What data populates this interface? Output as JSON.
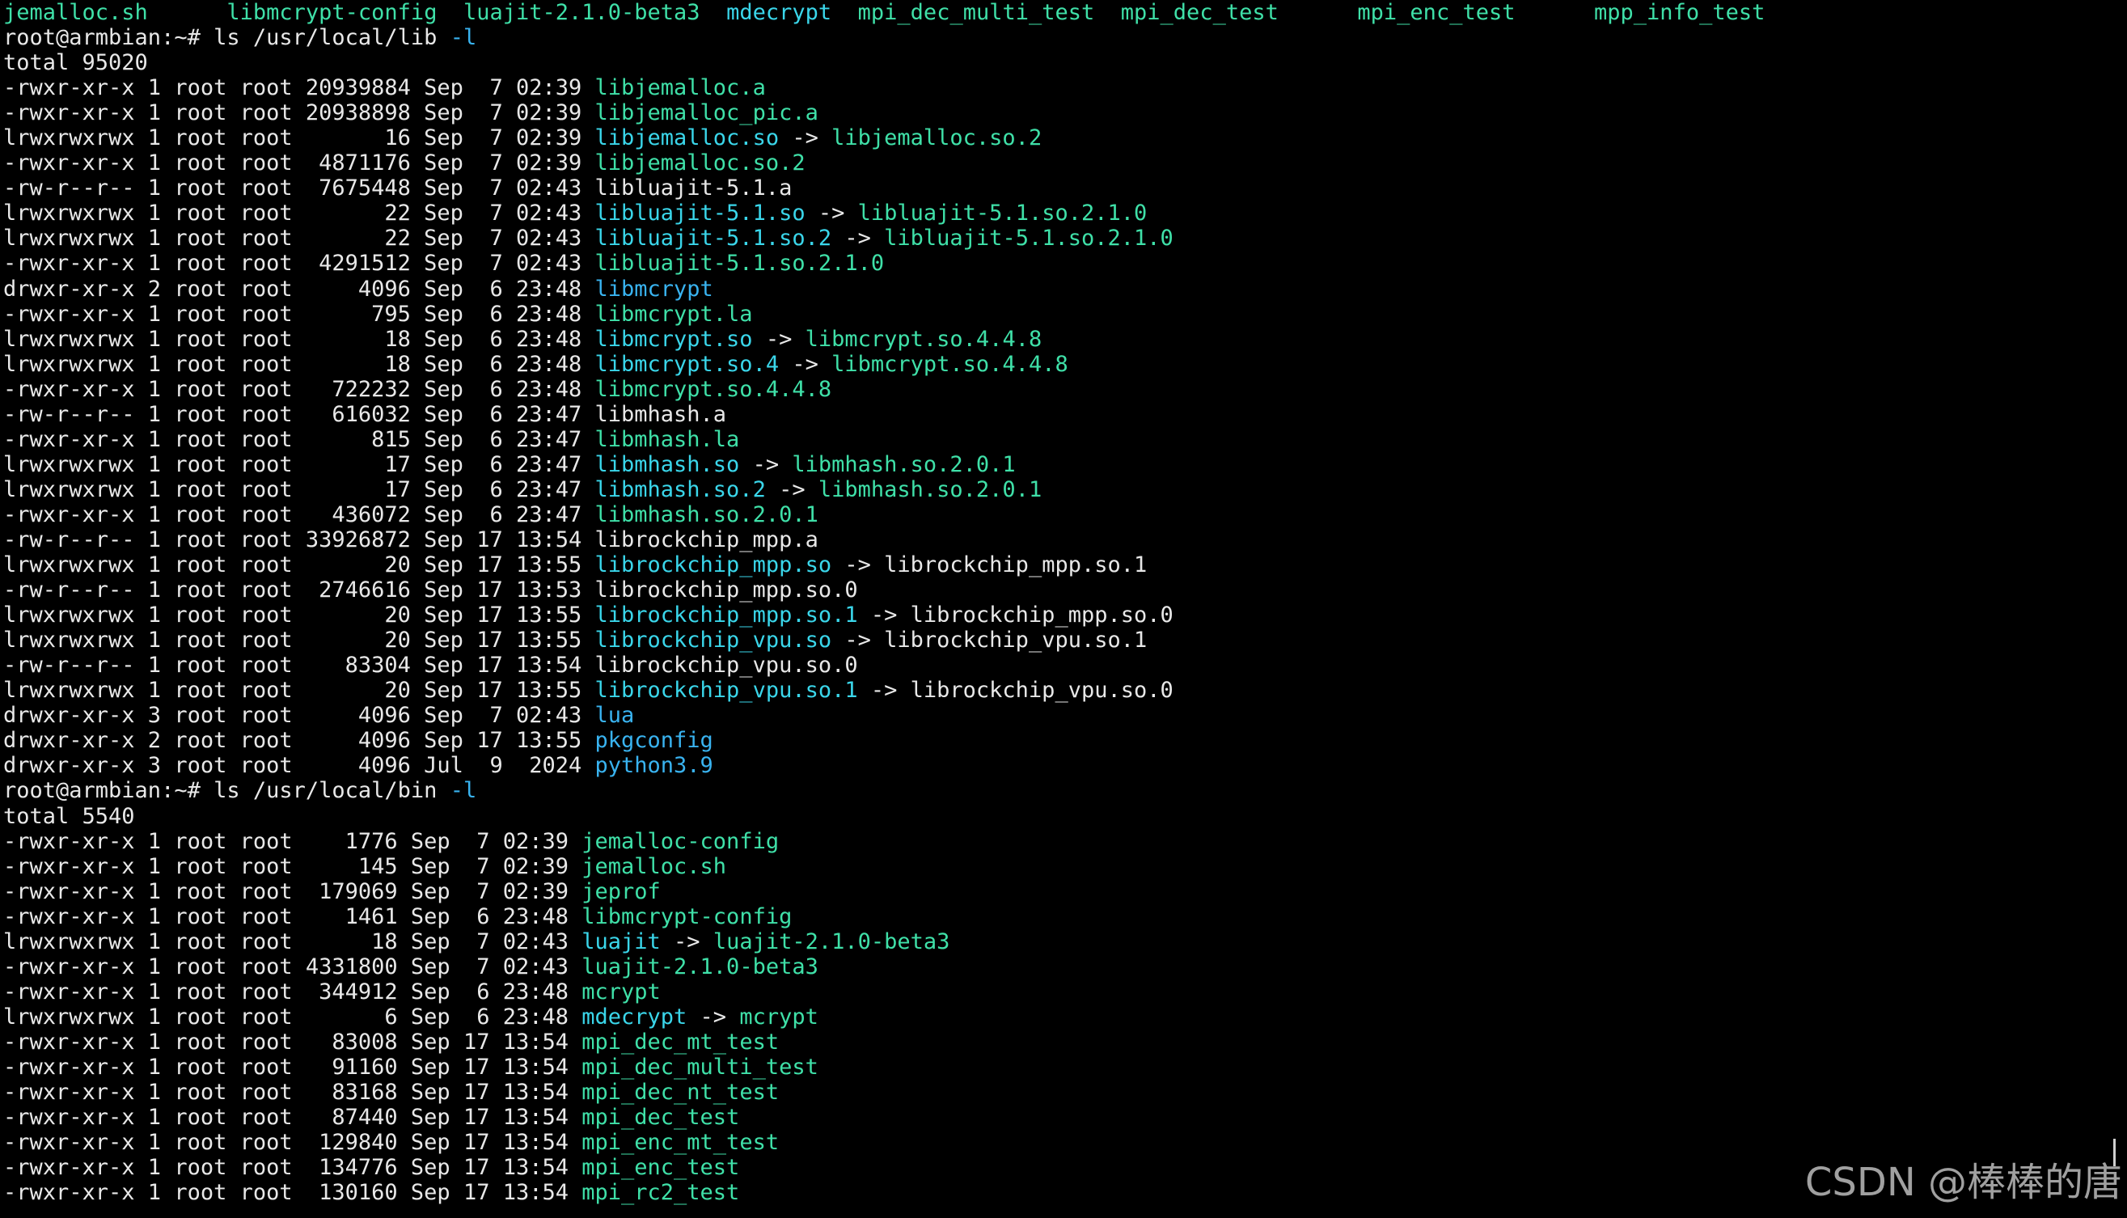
{
  "theme": {
    "background": "#000000",
    "text": "#e8e8e8",
    "executable": "#3fe0a8",
    "symlink": "#3ad6ea",
    "directory": "#39b3f0",
    "option_flag": "#39b3f0"
  },
  "terminal": {
    "lines": [
      {
        "segs": [
          {
            "text": "jemalloc.sh",
            "cls": "g"
          },
          {
            "text": "      ",
            "cls": "w"
          },
          {
            "text": "libmcrypt-config",
            "cls": "g"
          },
          {
            "text": "  ",
            "cls": "w"
          },
          {
            "text": "luajit-2.1.0-beta3",
            "cls": "g"
          },
          {
            "text": "  ",
            "cls": "w"
          },
          {
            "text": "mdecrypt",
            "cls": "l"
          },
          {
            "text": "  ",
            "cls": "w"
          },
          {
            "text": "mpi_dec_multi_test",
            "cls": "g"
          },
          {
            "text": "  ",
            "cls": "w"
          },
          {
            "text": "mpi_dec_test",
            "cls": "g"
          },
          {
            "text": "      ",
            "cls": "w"
          },
          {
            "text": "mpi_enc_test",
            "cls": "g"
          },
          {
            "text": "      ",
            "cls": "w"
          },
          {
            "text": "mpp_info_test",
            "cls": "g"
          }
        ]
      },
      {
        "segs": [
          {
            "text": "root@armbian:~# ls /usr/local/lib ",
            "cls": "w"
          },
          {
            "text": "-l",
            "cls": "b"
          }
        ]
      },
      {
        "segs": [
          {
            "text": "total 95020",
            "cls": "w"
          }
        ]
      },
      {
        "segs": [
          {
            "text": "-rwxr-xr-x 1 root root 20939884 Sep  7 02:39 ",
            "cls": "w"
          },
          {
            "text": "libjemalloc.a",
            "cls": "g"
          }
        ]
      },
      {
        "segs": [
          {
            "text": "-rwxr-xr-x 1 root root 20938898 Sep  7 02:39 ",
            "cls": "w"
          },
          {
            "text": "libjemalloc_pic.a",
            "cls": "g"
          }
        ]
      },
      {
        "segs": [
          {
            "text": "lrwxrwxrwx 1 root root       16 Sep  7 02:39 ",
            "cls": "w"
          },
          {
            "text": "libjemalloc.so",
            "cls": "l"
          },
          {
            "text": " -> ",
            "cls": "w"
          },
          {
            "text": "libjemalloc.so.2",
            "cls": "g"
          }
        ]
      },
      {
        "segs": [
          {
            "text": "-rwxr-xr-x 1 root root  4871176 Sep  7 02:39 ",
            "cls": "w"
          },
          {
            "text": "libjemalloc.so.2",
            "cls": "g"
          }
        ]
      },
      {
        "segs": [
          {
            "text": "-rw-r--r-- 1 root root  7675448 Sep  7 02:43 libluajit-5.1.a",
            "cls": "w"
          }
        ]
      },
      {
        "segs": [
          {
            "text": "lrwxrwxrwx 1 root root       22 Sep  7 02:43 ",
            "cls": "w"
          },
          {
            "text": "libluajit-5.1.so",
            "cls": "l"
          },
          {
            "text": " -> ",
            "cls": "w"
          },
          {
            "text": "libluajit-5.1.so.2.1.0",
            "cls": "g"
          }
        ]
      },
      {
        "segs": [
          {
            "text": "lrwxrwxrwx 1 root root       22 Sep  7 02:43 ",
            "cls": "w"
          },
          {
            "text": "libluajit-5.1.so.2",
            "cls": "l"
          },
          {
            "text": " -> ",
            "cls": "w"
          },
          {
            "text": "libluajit-5.1.so.2.1.0",
            "cls": "g"
          }
        ]
      },
      {
        "segs": [
          {
            "text": "-rwxr-xr-x 1 root root  4291512 Sep  7 02:43 ",
            "cls": "w"
          },
          {
            "text": "libluajit-5.1.so.2.1.0",
            "cls": "g"
          }
        ]
      },
      {
        "segs": [
          {
            "text": "drwxr-xr-x 2 root root     4096 Sep  6 23:48 ",
            "cls": "w"
          },
          {
            "text": "libmcrypt",
            "cls": "c"
          }
        ]
      },
      {
        "segs": [
          {
            "text": "-rwxr-xr-x 1 root root      795 Sep  6 23:48 ",
            "cls": "w"
          },
          {
            "text": "libmcrypt.la",
            "cls": "g"
          }
        ]
      },
      {
        "segs": [
          {
            "text": "lrwxrwxrwx 1 root root       18 Sep  6 23:48 ",
            "cls": "w"
          },
          {
            "text": "libmcrypt.so",
            "cls": "l"
          },
          {
            "text": " -> ",
            "cls": "w"
          },
          {
            "text": "libmcrypt.so.4.4.8",
            "cls": "g"
          }
        ]
      },
      {
        "segs": [
          {
            "text": "lrwxrwxrwx 1 root root       18 Sep  6 23:48 ",
            "cls": "w"
          },
          {
            "text": "libmcrypt.so.4",
            "cls": "l"
          },
          {
            "text": " -> ",
            "cls": "w"
          },
          {
            "text": "libmcrypt.so.4.4.8",
            "cls": "g"
          }
        ]
      },
      {
        "segs": [
          {
            "text": "-rwxr-xr-x 1 root root   722232 Sep  6 23:48 ",
            "cls": "w"
          },
          {
            "text": "libmcrypt.so.4.4.8",
            "cls": "g"
          }
        ]
      },
      {
        "segs": [
          {
            "text": "-rw-r--r-- 1 root root   616032 Sep  6 23:47 libmhash.a",
            "cls": "w"
          }
        ]
      },
      {
        "segs": [
          {
            "text": "-rwxr-xr-x 1 root root      815 Sep  6 23:47 ",
            "cls": "w"
          },
          {
            "text": "libmhash.la",
            "cls": "g"
          }
        ]
      },
      {
        "segs": [
          {
            "text": "lrwxrwxrwx 1 root root       17 Sep  6 23:47 ",
            "cls": "w"
          },
          {
            "text": "libmhash.so",
            "cls": "l"
          },
          {
            "text": " -> ",
            "cls": "w"
          },
          {
            "text": "libmhash.so.2.0.1",
            "cls": "g"
          }
        ]
      },
      {
        "segs": [
          {
            "text": "lrwxrwxrwx 1 root root       17 Sep  6 23:47 ",
            "cls": "w"
          },
          {
            "text": "libmhash.so.2",
            "cls": "l"
          },
          {
            "text": " -> ",
            "cls": "w"
          },
          {
            "text": "libmhash.so.2.0.1",
            "cls": "g"
          }
        ]
      },
      {
        "segs": [
          {
            "text": "-rwxr-xr-x 1 root root   436072 Sep  6 23:47 ",
            "cls": "w"
          },
          {
            "text": "libmhash.so.2.0.1",
            "cls": "g"
          }
        ]
      },
      {
        "segs": [
          {
            "text": "-rw-r--r-- 1 root root 33926872 Sep 17 13:54 librockchip_mpp.a",
            "cls": "w"
          }
        ]
      },
      {
        "segs": [
          {
            "text": "lrwxrwxrwx 1 root root       20 Sep 17 13:55 ",
            "cls": "w"
          },
          {
            "text": "librockchip_mpp.so",
            "cls": "l"
          },
          {
            "text": " -> librockchip_mpp.so.1",
            "cls": "w"
          }
        ]
      },
      {
        "segs": [
          {
            "text": "-rw-r--r-- 1 root root  2746616 Sep 17 13:53 librockchip_mpp.so.0",
            "cls": "w"
          }
        ]
      },
      {
        "segs": [
          {
            "text": "lrwxrwxrwx 1 root root       20 Sep 17 13:55 ",
            "cls": "w"
          },
          {
            "text": "librockchip_mpp.so.1",
            "cls": "l"
          },
          {
            "text": " -> librockchip_mpp.so.0",
            "cls": "w"
          }
        ]
      },
      {
        "segs": [
          {
            "text": "lrwxrwxrwx 1 root root       20 Sep 17 13:55 ",
            "cls": "w"
          },
          {
            "text": "librockchip_vpu.so",
            "cls": "l"
          },
          {
            "text": " -> librockchip_vpu.so.1",
            "cls": "w"
          }
        ]
      },
      {
        "segs": [
          {
            "text": "-rw-r--r-- 1 root root    83304 Sep 17 13:54 librockchip_vpu.so.0",
            "cls": "w"
          }
        ]
      },
      {
        "segs": [
          {
            "text": "lrwxrwxrwx 1 root root       20 Sep 17 13:55 ",
            "cls": "w"
          },
          {
            "text": "librockchip_vpu.so.1",
            "cls": "l"
          },
          {
            "text": " -> librockchip_vpu.so.0",
            "cls": "w"
          }
        ]
      },
      {
        "segs": [
          {
            "text": "drwxr-xr-x 3 root root     4096 Sep  7 02:43 ",
            "cls": "w"
          },
          {
            "text": "lua",
            "cls": "c"
          }
        ]
      },
      {
        "segs": [
          {
            "text": "drwxr-xr-x 2 root root     4096 Sep 17 13:55 ",
            "cls": "w"
          },
          {
            "text": "pkgconfig",
            "cls": "c"
          }
        ]
      },
      {
        "segs": [
          {
            "text": "drwxr-xr-x 3 root root     4096 Jul  9  2024 ",
            "cls": "w"
          },
          {
            "text": "python3.9",
            "cls": "c"
          }
        ]
      },
      {
        "segs": [
          {
            "text": "root@armbian:~# ls /usr/local/bin ",
            "cls": "w"
          },
          {
            "text": "-l",
            "cls": "b"
          }
        ]
      },
      {
        "segs": [
          {
            "text": "total 5540",
            "cls": "w"
          }
        ]
      },
      {
        "segs": [
          {
            "text": "-rwxr-xr-x 1 root root    1776 Sep  7 02:39 ",
            "cls": "w"
          },
          {
            "text": "jemalloc-config",
            "cls": "g"
          }
        ]
      },
      {
        "segs": [
          {
            "text": "-rwxr-xr-x 1 root root     145 Sep  7 02:39 ",
            "cls": "w"
          },
          {
            "text": "jemalloc.sh",
            "cls": "g"
          }
        ]
      },
      {
        "segs": [
          {
            "text": "-rwxr-xr-x 1 root root  179069 Sep  7 02:39 ",
            "cls": "w"
          },
          {
            "text": "jeprof",
            "cls": "g"
          }
        ]
      },
      {
        "segs": [
          {
            "text": "-rwxr-xr-x 1 root root    1461 Sep  6 23:48 ",
            "cls": "w"
          },
          {
            "text": "libmcrypt-config",
            "cls": "g"
          }
        ]
      },
      {
        "segs": [
          {
            "text": "lrwxrwxrwx 1 root root      18 Sep  7 02:43 ",
            "cls": "w"
          },
          {
            "text": "luajit",
            "cls": "l"
          },
          {
            "text": " -> ",
            "cls": "w"
          },
          {
            "text": "luajit-2.1.0-beta3",
            "cls": "g"
          }
        ]
      },
      {
        "segs": [
          {
            "text": "-rwxr-xr-x 1 root root 4331800 Sep  7 02:43 ",
            "cls": "w"
          },
          {
            "text": "luajit-2.1.0-beta3",
            "cls": "g"
          }
        ]
      },
      {
        "segs": [
          {
            "text": "-rwxr-xr-x 1 root root  344912 Sep  6 23:48 ",
            "cls": "w"
          },
          {
            "text": "mcrypt",
            "cls": "g"
          }
        ]
      },
      {
        "segs": [
          {
            "text": "lrwxrwxrwx 1 root root       6 Sep  6 23:48 ",
            "cls": "w"
          },
          {
            "text": "mdecrypt",
            "cls": "l"
          },
          {
            "text": " -> ",
            "cls": "w"
          },
          {
            "text": "mcrypt",
            "cls": "g"
          }
        ]
      },
      {
        "segs": [
          {
            "text": "-rwxr-xr-x 1 root root   83008 Sep 17 13:54 ",
            "cls": "w"
          },
          {
            "text": "mpi_dec_mt_test",
            "cls": "g"
          }
        ]
      },
      {
        "segs": [
          {
            "text": "-rwxr-xr-x 1 root root   91160 Sep 17 13:54 ",
            "cls": "w"
          },
          {
            "text": "mpi_dec_multi_test",
            "cls": "g"
          }
        ]
      },
      {
        "segs": [
          {
            "text": "-rwxr-xr-x 1 root root   83168 Sep 17 13:54 ",
            "cls": "w"
          },
          {
            "text": "mpi_dec_nt_test",
            "cls": "g"
          }
        ]
      },
      {
        "segs": [
          {
            "text": "-rwxr-xr-x 1 root root   87440 Sep 17 13:54 ",
            "cls": "w"
          },
          {
            "text": "mpi_dec_test",
            "cls": "g"
          }
        ]
      },
      {
        "segs": [
          {
            "text": "-rwxr-xr-x 1 root root  129840 Sep 17 13:54 ",
            "cls": "w"
          },
          {
            "text": "mpi_enc_mt_test",
            "cls": "g"
          }
        ]
      },
      {
        "segs": [
          {
            "text": "-rwxr-xr-x 1 root root  134776 Sep 17 13:54 ",
            "cls": "w"
          },
          {
            "text": "mpi_enc_test",
            "cls": "g"
          }
        ]
      },
      {
        "segs": [
          {
            "text": "-rwxr-xr-x 1 root root  130160 Sep 17 13:54 ",
            "cls": "w"
          },
          {
            "text": "mpi_rc2_test",
            "cls": "g"
          }
        ]
      }
    ]
  },
  "watermark": {
    "text": "CSDN @棒棒的唐"
  }
}
